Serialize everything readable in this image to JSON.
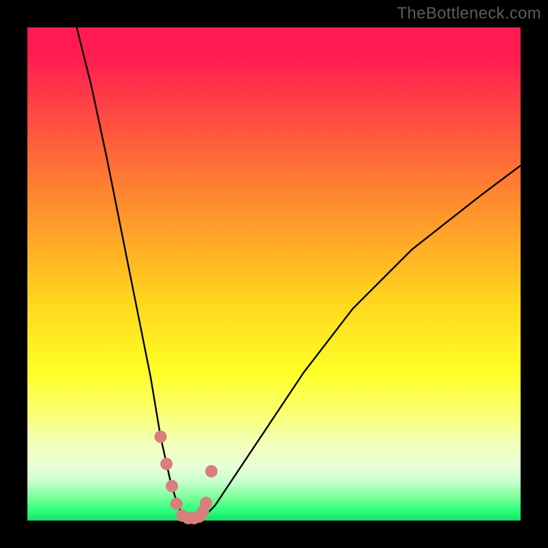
{
  "watermark": "TheBottleneck.com",
  "chart_data": {
    "type": "line",
    "title": "",
    "xlabel": "",
    "ylabel": "",
    "xlim": [
      0,
      100
    ],
    "ylim": [
      0,
      100
    ],
    "series": [
      {
        "name": "bottleneck-curve",
        "x": [
          10,
          13,
          16,
          19,
          22,
          25,
          27,
          29,
          30.5,
          32,
          34,
          36,
          38,
          42,
          48,
          56,
          66,
          78,
          92,
          100
        ],
        "values": [
          100,
          88,
          74,
          59,
          44,
          29,
          17,
          8,
          3,
          0.5,
          0.5,
          1,
          3,
          9,
          18,
          30,
          43,
          55,
          66,
          72
        ]
      }
    ],
    "markers": {
      "name": "highlight-dots",
      "x": [
        27.0,
        28.2,
        29.3,
        30.2,
        31.4,
        32.6,
        33.8,
        34.8,
        35.6,
        36.2,
        37.3
      ],
      "values": [
        17.0,
        11.5,
        7.0,
        3.4,
        1.0,
        0.5,
        0.5,
        0.8,
        1.8,
        3.6,
        10.0
      ]
    },
    "colors": {
      "curve": "#000000",
      "markers": "#d87f7e"
    }
  }
}
